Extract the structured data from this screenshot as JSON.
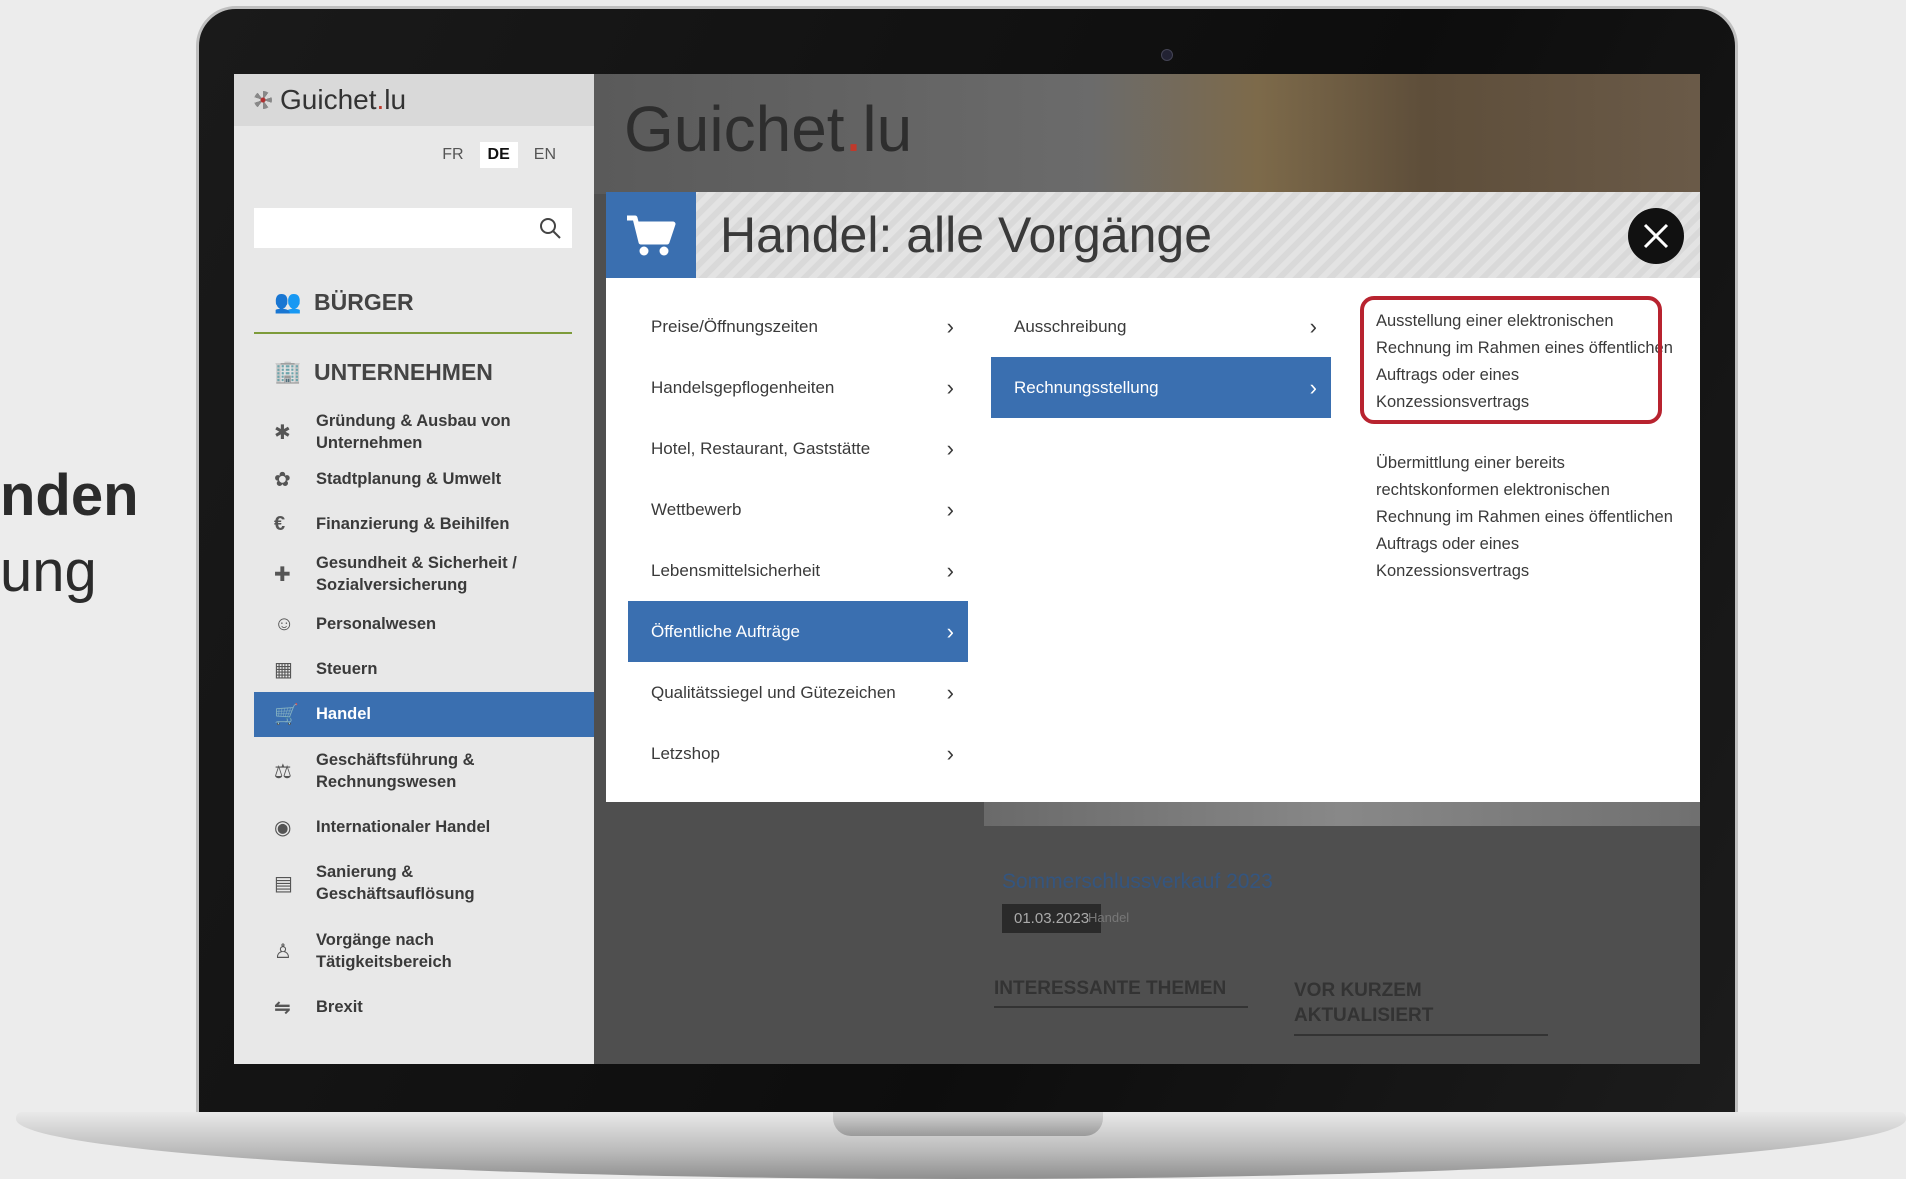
{
  "slide": {
    "line1": "nden",
    "line2": "ung"
  },
  "sidebar": {
    "logo": "Guichet",
    "logo_dot": ".",
    "logo_tld": "lu",
    "languages": [
      "FR",
      "DE",
      "EN"
    ],
    "active_language": "DE",
    "search_placeholder": "",
    "main_nav": [
      {
        "label": "BÜRGER",
        "icon": "people-icon"
      },
      {
        "label": "UNTERNEHMEN",
        "icon": "building-icon"
      }
    ],
    "items": [
      {
        "label": "Gründung & Ausbau von Unternehmen",
        "icon": "puzzle-icon"
      },
      {
        "label": "Stadtplanung & Umwelt",
        "icon": "leaf-icon"
      },
      {
        "label": "Finanzierung & Beihilfen",
        "icon": "euro-icon"
      },
      {
        "label": "Gesundheit & Sicherheit / Sozialversicherung",
        "icon": "medkit-icon"
      },
      {
        "label": "Personalwesen",
        "icon": "person-cycle-icon"
      },
      {
        "label": "Steuern",
        "icon": "calculator-icon"
      },
      {
        "label": "Handel",
        "icon": "cart-icon"
      },
      {
        "label": "Geschäftsführung & Rechnungswesen",
        "icon": "scales-icon"
      },
      {
        "label": "Internationaler Handel",
        "icon": "globe-icon"
      },
      {
        "label": "Sanierung & Geschäftsauflösung",
        "icon": "chart-down-icon"
      },
      {
        "label": "Vorgänge nach Tätigkeitsbereich",
        "icon": "group-icon"
      },
      {
        "label": "Brexit",
        "icon": "brexit-icon"
      }
    ],
    "active_item": "Handel"
  },
  "main": {
    "hero_logo": "Guichet",
    "hero_dot": ".",
    "hero_tld": "lu",
    "news_title": "Sommerschlussverkauf 2023",
    "news_date": "01.03.2023",
    "news_category": "Handel",
    "section1": "INTERESSANTE THEMEN",
    "section2_line1": "VOR KURZEM",
    "section2_line2": "AKTUALISIERT"
  },
  "modal": {
    "title": "Handel: alle Vorgänge",
    "col1": [
      "Preise/Öffnungszeiten",
      "Handelsgepflogenheiten",
      "Hotel, Restaurant, Gaststätte",
      "Wettbewerb",
      "Lebensmittelsicherheit",
      "Öffentliche Aufträge",
      "Qualitätssiegel und Gütezeichen",
      "Letzshop"
    ],
    "col1_active": "Öffentliche Aufträge",
    "col2": [
      "Ausschreibung",
      "Rechnungsstellung"
    ],
    "col2_active": "Rechnungsstellung",
    "col3": [
      "Ausstellung einer elektronischen Rechnung im Rahmen eines öffentlichen Auftrags oder eines Konzessionsvertrags",
      "Übermittlung einer bereits rechtskonformen elektronischen Rechnung im Rahmen eines öffentlichen Auftrags oder eines Konzessionsvertrags"
    ],
    "highlight_color": "#b8232f",
    "accent_color": "#3a6fb0"
  }
}
